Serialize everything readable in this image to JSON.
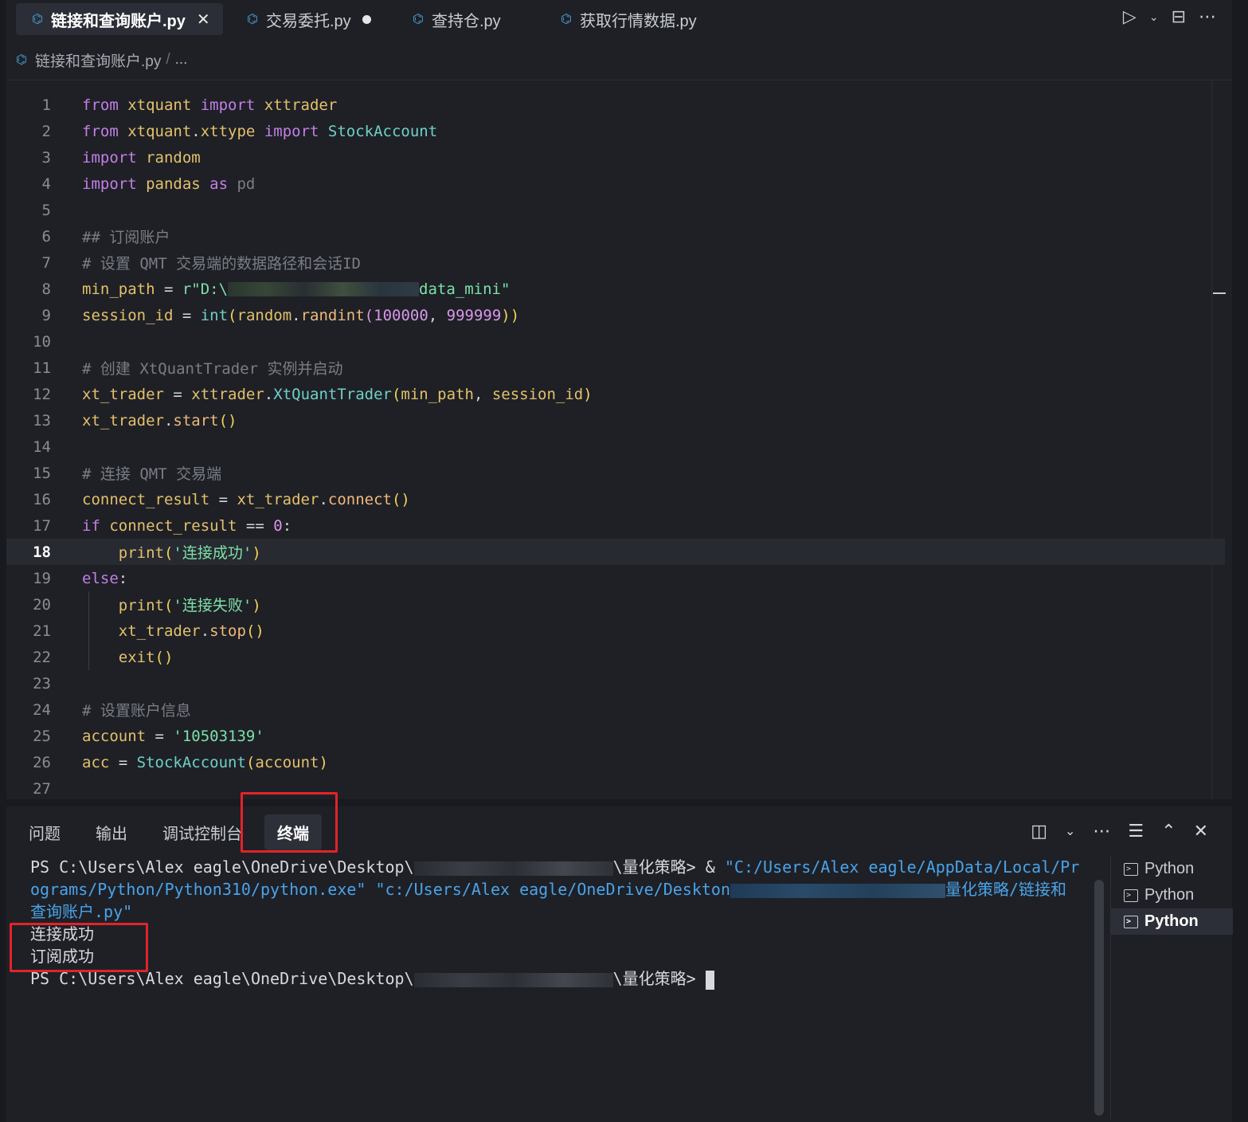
{
  "tabs": [
    {
      "label": "链接和查询账户.py",
      "active": true,
      "state": "close"
    },
    {
      "label": "交易委托.py",
      "active": false,
      "state": "dirty"
    },
    {
      "label": "查持仓.py",
      "active": false,
      "state": ""
    },
    {
      "label": "获取行情数据.py",
      "active": false,
      "state": ""
    }
  ],
  "breadcrumb": {
    "file": "链接和查询账户.py",
    "sep": "/",
    "more": "..."
  },
  "editor": {
    "current_line": 18,
    "lines": [
      "1",
      "2",
      "3",
      "4",
      "5",
      "6",
      "7",
      "8",
      "9",
      "10",
      "11",
      "12",
      "13",
      "14",
      "15",
      "16",
      "17",
      "18",
      "19",
      "20",
      "21",
      "22",
      "23",
      "24",
      "25",
      "26",
      "27"
    ],
    "tokens": {
      "l1": [
        "from",
        " xtquant ",
        "import",
        " xttrader"
      ],
      "l2": [
        "from",
        " xtquant",
        ".",
        "xttype ",
        "import",
        " StockAccount"
      ],
      "l3": [
        "import",
        " random"
      ],
      "l4": [
        "import",
        " pandas ",
        "as",
        " pd"
      ],
      "l6": "## 订阅账户",
      "l7": "# 设置 QMT 交易端的数据路径和会话ID",
      "l8": [
        "min_path",
        " = ",
        "r\"D:\\",
        "data_mini\""
      ],
      "l9": [
        "session_id",
        " = ",
        "int",
        "(",
        "random",
        ".",
        "randint",
        "(",
        "100000",
        ", ",
        "999999",
        "))"
      ],
      "l11": "# 创建 XtQuantTrader 实例并启动",
      "l12": [
        "xt_trader",
        " = ",
        "xttrader",
        ".",
        "XtQuantTrader",
        "(",
        "min_path",
        ", ",
        "session_id",
        ")"
      ],
      "l13": [
        "xt_trader",
        ".",
        "start",
        "()"
      ],
      "l15": "# 连接 QMT 交易端",
      "l16": [
        "connect_result",
        " = ",
        "xt_trader",
        ".",
        "connect",
        "()"
      ],
      "l17": [
        "if",
        " connect_result ",
        "==",
        " ",
        "0",
        ":"
      ],
      "l18": [
        "print",
        "(",
        "'连接成功'",
        ")"
      ],
      "l19": [
        "else",
        ":"
      ],
      "l20": [
        "print",
        "(",
        "'连接失败'",
        ")"
      ],
      "l21": [
        "xt_trader",
        ".",
        "stop",
        "()"
      ],
      "l22": [
        "exit",
        "()"
      ],
      "l24": "# 设置账户信息",
      "l25": [
        "account",
        " = ",
        "'10503139'"
      ],
      "l26": [
        "acc",
        " = ",
        "StockAccount",
        "(",
        "account",
        ")"
      ]
    }
  },
  "panel": {
    "tabs": [
      "问题",
      "输出",
      "调试控制台",
      "终端"
    ],
    "active_tab": "终端",
    "terminal": {
      "line1_prefix": "PS C:\\Users\\Alex eagle\\OneDrive\\Desktop\\",
      "line1_suffix": "\\量化策略> & ",
      "line1_path": "\"C:/Users/Alex eagle/AppData/Local/Pr",
      "line2_path": "ograms/Python/Python310/python.exe\" \"c:/Users/Alex eagle/OneDrive/Deskton",
      "line2_tail": "量化策略/链接和",
      "line3_path": "查询账户.py\"",
      "out1": "连接成功",
      "out2": "订阅成功",
      "prompt_prefix": "PS C:\\Users\\Alex eagle\\OneDrive\\Desktop\\",
      "prompt_suffix": "\\量化策略> "
    },
    "terminals": [
      {
        "label": "Python",
        "active": false
      },
      {
        "label": "Python",
        "active": false
      },
      {
        "label": "Python",
        "active": true
      }
    ]
  },
  "colors": {
    "highlight": "#e0242a",
    "keyword": "#c37fe6",
    "string": "#7ee0a8",
    "number": "#d997e8"
  }
}
